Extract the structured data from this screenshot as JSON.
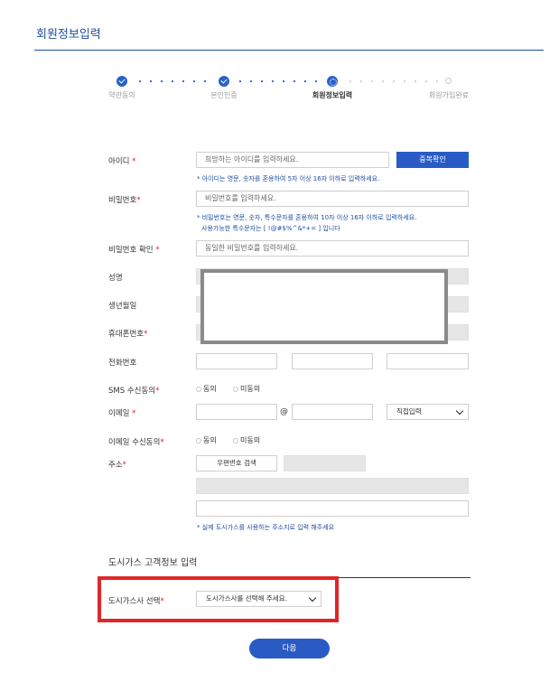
{
  "page": {
    "title": "회원정보입력"
  },
  "stepper": {
    "steps": [
      {
        "label": "약관동의",
        "state": "done"
      },
      {
        "label": "본인인증",
        "state": "done"
      },
      {
        "label": "회원정보입력",
        "state": "current"
      },
      {
        "label": "회원가입완료",
        "state": "todo"
      }
    ]
  },
  "form": {
    "id": {
      "label": "아이디",
      "placeholder": "희망하는 아이디를 입력하세요.",
      "check_button": "중복확인",
      "hint": "* 아이디는 영문, 숫자를 혼용하여 5자 이상 16자 이하로 입력하세요."
    },
    "password": {
      "label": "비밀번호",
      "placeholder": "비밀번호를 입력하세요.",
      "hint_line1": "* 비밀번호는 영문, 숫자, 특수문자를 혼용하여 10자 이상 16자 이하로 입력하세요.",
      "hint_line2": "사용가능한 특수문자는 [ !@#$%^&*+= ] 입니다"
    },
    "password_confirm": {
      "label": "비밀번호 확인",
      "placeholder": "동일한 비밀번호를 입력하세요."
    },
    "name": {
      "label": "성명"
    },
    "birth": {
      "label": "생년월일"
    },
    "mobile": {
      "label": "휴대폰번호"
    },
    "phone": {
      "label": "전화번호"
    },
    "sms": {
      "label": "SMS 수신동의",
      "agree": "동의",
      "disagree": "미동의"
    },
    "email": {
      "label": "이메일",
      "at": "@",
      "domain_select": "직접입력"
    },
    "email_consent": {
      "label": "이메일 수신동의",
      "agree": "동의",
      "disagree": "미동의"
    },
    "address": {
      "label": "주소",
      "zip_button": "우편번호 검색",
      "hint": "* 실제 도시가스를 사용하는 주소지로 입력 해주세요"
    },
    "required_mark": "*"
  },
  "gas_section": {
    "title": "도시가스 고객정보 입력",
    "company_label": "도시가스사 선택",
    "company_select": "도시가스사를 선택해 주세요."
  },
  "actions": {
    "next_button": "다음"
  },
  "colors": {
    "primary": "#2a5bc4",
    "required": "#d9232d",
    "highlight": "#e0262a"
  }
}
